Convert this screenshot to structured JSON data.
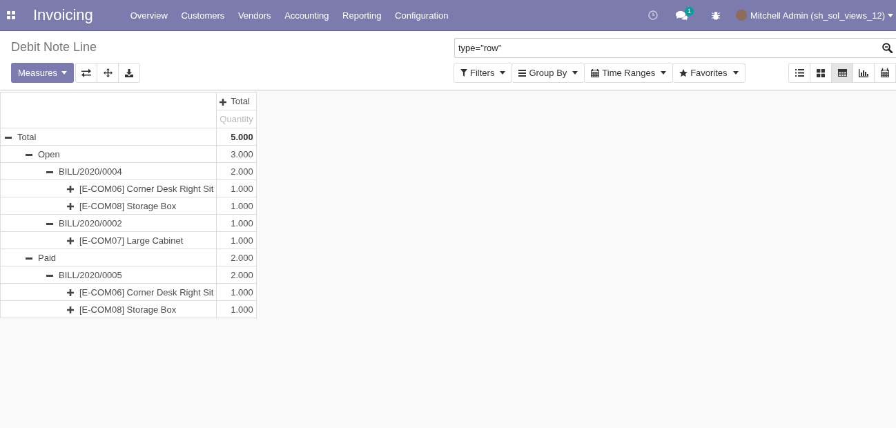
{
  "navbar": {
    "app_name": "Invoicing",
    "menu": [
      "Overview",
      "Customers",
      "Vendors",
      "Accounting",
      "Reporting",
      "Configuration"
    ],
    "chat_count": "1",
    "user": "Mitchell Admin (sh_sol_views_12)"
  },
  "control_panel": {
    "title": "Debit Note Line",
    "measures_button": "Measures",
    "search": {
      "value": "type=\"row\""
    },
    "search_options": [
      {
        "kind": "filter",
        "label": "Filters"
      },
      {
        "kind": "groupby",
        "label": "Group By"
      },
      {
        "kind": "timeranges",
        "label": "Time Ranges"
      },
      {
        "kind": "favorites",
        "label": "Favorites"
      }
    ],
    "views": [
      {
        "kind": "list",
        "selected": false
      },
      {
        "kind": "kanban",
        "selected": false
      },
      {
        "kind": "pivot",
        "selected": true
      },
      {
        "kind": "graph",
        "selected": false
      },
      {
        "kind": "calendar",
        "selected": false
      }
    ]
  },
  "pivot": {
    "column_header": {
      "label": "Total",
      "expanded": false
    },
    "measure": "Quantity",
    "rows": [
      {
        "label": "Total",
        "value": "5.000",
        "expanded": true,
        "children": [
          {
            "label": "Open",
            "value": "3.000",
            "expanded": true,
            "children": [
              {
                "label": "BILL/2020/0004",
                "value": "2.000",
                "expanded": true,
                "children": [
                  {
                    "label": "[E-COM06] Corner Desk Right Sit",
                    "value": "1.000",
                    "expanded": false
                  },
                  {
                    "label": "[E-COM08] Storage Box",
                    "value": "1.000",
                    "expanded": false
                  }
                ]
              },
              {
                "label": "BILL/2020/0002",
                "value": "1.000",
                "expanded": true,
                "children": [
                  {
                    "label": "[E-COM07] Large Cabinet",
                    "value": "1.000",
                    "expanded": false
                  }
                ]
              }
            ]
          },
          {
            "label": "Paid",
            "value": "2.000",
            "expanded": true,
            "children": [
              {
                "label": "BILL/2020/0005",
                "value": "2.000",
                "expanded": true,
                "children": [
                  {
                    "label": "[E-COM06] Corner Desk Right Sit",
                    "value": "1.000",
                    "expanded": false
                  },
                  {
                    "label": "[E-COM08] Storage Box",
                    "value": "1.000",
                    "expanded": false
                  }
                ]
              }
            ]
          }
        ]
      }
    ]
  }
}
